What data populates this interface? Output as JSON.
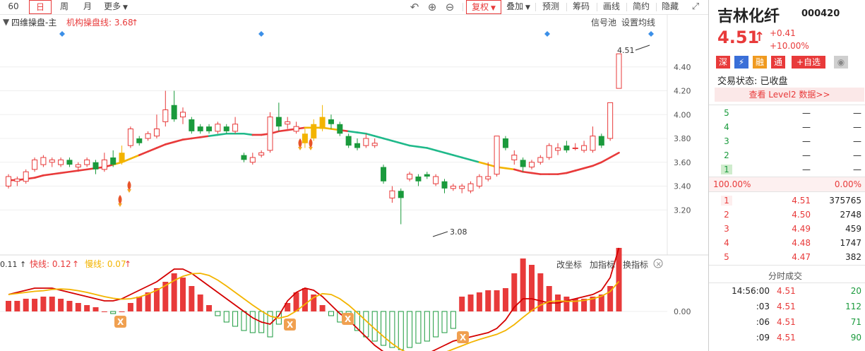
{
  "toolbar": {
    "items": [
      "60",
      "日",
      "周",
      "月",
      "更多",
      "复权",
      "叠加",
      "预测",
      "筹码",
      "画线",
      "简约",
      "隐藏>>"
    ],
    "active": "日"
  },
  "header": {
    "title": "四维操盘-主",
    "indicator": "机构操盘线: 3.68",
    "arrow": "↑",
    "right_links": [
      "信号池",
      "设置均线"
    ]
  },
  "price_axis": [
    "4.40",
    "4.20",
    "4.00",
    "3.80",
    "3.60",
    "3.40",
    "3.20"
  ],
  "callouts": {
    "high": "4.51",
    "low": "3.08"
  },
  "sub_header": {
    "first": "0.11 ↑",
    "fast": "快线: 0.12",
    "slow": "慢线: 0.07",
    "fast_arrow": "↑",
    "slow_arrow": "↑",
    "right_links": [
      "改坐标",
      "加指标",
      "换指标"
    ]
  },
  "sub_axis": "0.00",
  "stock": {
    "name": "吉林化纤",
    "code": "000420",
    "price": "4.51",
    "arrow": "↑",
    "change": "+0.41",
    "pct": "+10.00%",
    "status": "交易状态: 已收盘",
    "level2": "查看 Level2 数据>>"
  },
  "badges": [
    "深",
    "⚡",
    "融",
    "通",
    "+自选"
  ],
  "asks": [
    {
      "n": "5",
      "p": "—",
      "v": "—"
    },
    {
      "n": "4",
      "p": "—",
      "v": "—"
    },
    {
      "n": "3",
      "p": "—",
      "v": "—"
    },
    {
      "n": "2",
      "p": "—",
      "v": "—"
    },
    {
      "n": "1",
      "p": "—",
      "v": "—"
    }
  ],
  "ratio": {
    "left": "100.00%",
    "right": "0.00%"
  },
  "bids": [
    {
      "n": "1",
      "p": "4.51",
      "v": "375765"
    },
    {
      "n": "2",
      "p": "4.50",
      "v": "2748"
    },
    {
      "n": "3",
      "p": "4.49",
      "v": "459"
    },
    {
      "n": "4",
      "p": "4.48",
      "v": "1747"
    },
    {
      "n": "5",
      "p": "4.47",
      "v": "382"
    }
  ],
  "ticks_title": "分时成交",
  "ticks": [
    {
      "t": "14:56:00",
      "p": "4.51",
      "v": "20"
    },
    {
      "t": ":03",
      "p": "4.51",
      "v": "112"
    },
    {
      "t": ":06",
      "p": "4.51",
      "v": "71"
    },
    {
      "t": ":09",
      "p": "4.51",
      "v": "90"
    }
  ],
  "colors": {
    "up": "#e83a3a",
    "down": "#1a9a3c",
    "gold": "#f3b400",
    "teal": "#1fb98a"
  }
}
